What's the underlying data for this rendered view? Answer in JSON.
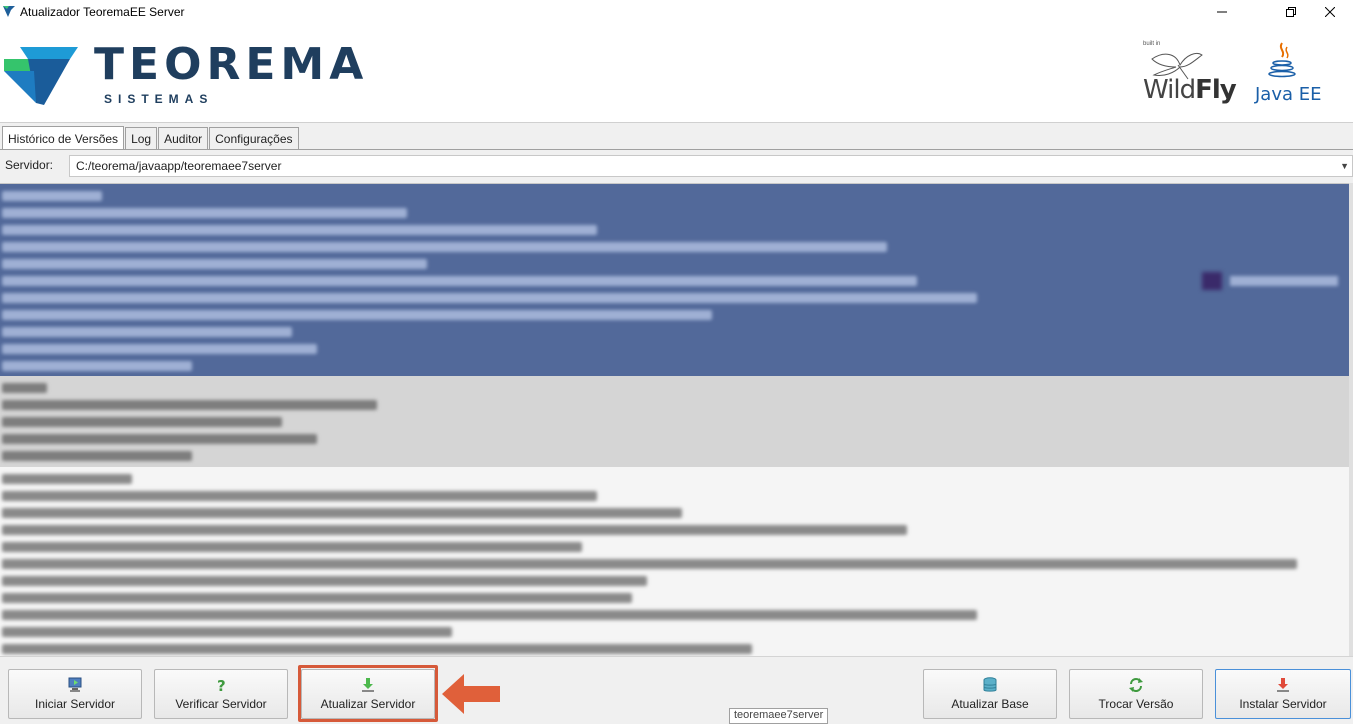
{
  "window": {
    "title": "Atualizador TeoremaEE Server",
    "controls": {
      "minimize": "—",
      "maximize": "❐",
      "close": "✕"
    }
  },
  "header": {
    "brand_name": "TEOREMA",
    "brand_sub": "SISTEMAS",
    "wildfly_built": "built in",
    "wildfly_prefix": "Wild",
    "wildfly_suffix": "Fly",
    "javaee": "Java EE"
  },
  "tabs": [
    {
      "label": "Histórico de Versões",
      "active": true
    },
    {
      "label": "Log",
      "active": false
    },
    {
      "label": "Auditor",
      "active": false
    },
    {
      "label": "Configurações",
      "active": false
    }
  ],
  "server": {
    "label": "Servidor:",
    "value": "C:/teorema/javaapp/teoremaee7server"
  },
  "toolbar": {
    "iniciar": "Iniciar Servidor",
    "verificar": "Verificar Servidor",
    "atualizar": "Atualizar Servidor",
    "atualizar_base": "Atualizar Base",
    "trocar_versao": "Trocar Versão",
    "instalar": "Instalar Servidor"
  },
  "tooltip": "teoremaee7server",
  "colors": {
    "selection": "#52699a",
    "brand": "#1f3e5e",
    "highlight": "#d65a3a"
  }
}
